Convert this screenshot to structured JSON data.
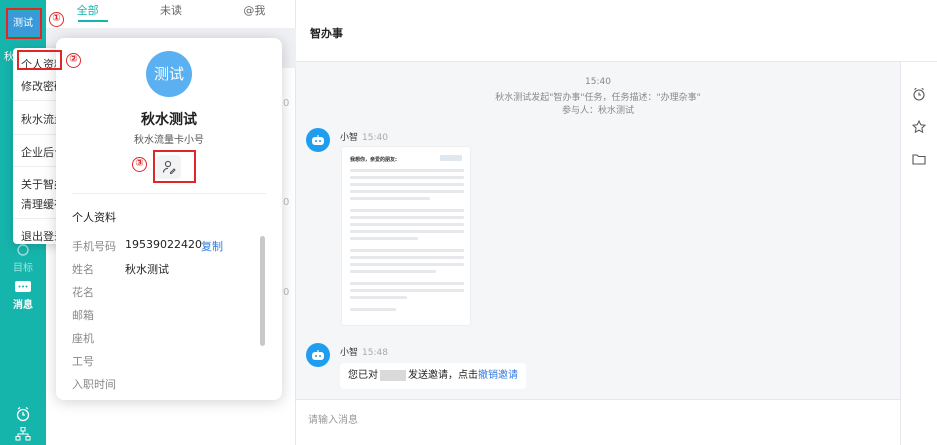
{
  "rail": {
    "avatar_label": "测试",
    "cut_label": "秋",
    "items": [
      {
        "label": "目标",
        "icon": "target-icon"
      },
      {
        "label": "消息",
        "icon": "message-icon"
      }
    ]
  },
  "tabs": [
    {
      "label": "全部",
      "active": true
    },
    {
      "label": "未读",
      "active": false
    },
    {
      "label": "@我",
      "active": false
    }
  ],
  "list_times": [
    "0",
    "0",
    "0"
  ],
  "menu": {
    "items": [
      {
        "label": "个人资料"
      },
      {
        "label": "修改密码"
      },
      {
        "label": "秋水流量"
      },
      {
        "label": "企业后台"
      },
      {
        "label": "关于智办"
      },
      {
        "label": "清理缓存"
      },
      {
        "label": "退出登录"
      }
    ]
  },
  "markers": [
    "①",
    "②",
    "③"
  ],
  "profile": {
    "avatar_text": "测试",
    "name": "秋水测试",
    "org": "秋水流量卡小号",
    "section_title": "个人资料",
    "copy_label": "复制",
    "fields": [
      {
        "label": "手机号码",
        "value": "19539022420"
      },
      {
        "label": "姓名",
        "value": "秋水测试"
      },
      {
        "label": "花名",
        "value": ""
      },
      {
        "label": "邮箱",
        "value": ""
      },
      {
        "label": "座机",
        "value": ""
      },
      {
        "label": "工号",
        "value": ""
      },
      {
        "label": "入职时间",
        "value": ""
      }
    ]
  },
  "chat": {
    "title": "智办事",
    "sys_time": "15:40",
    "sys_line1": "秋水测试发起\"智办事\"任务，任务描述：\"办理杂事\"",
    "sys_line2": "参与人：秋水测试",
    "msg1": {
      "sender": "小智",
      "time": "15:40"
    },
    "doc_greeting": "我想你，亲爱的朋友:",
    "msg2": {
      "sender": "小智",
      "time": "15:48",
      "text_a": "您已对",
      "text_b": "发送邀请，点击",
      "link": "撤销邀请"
    },
    "input_placeholder": "请输入消息"
  },
  "colors": {
    "accent": "#16b5ac",
    "link": "#2f7be0",
    "annotation": "#e0262b"
  }
}
